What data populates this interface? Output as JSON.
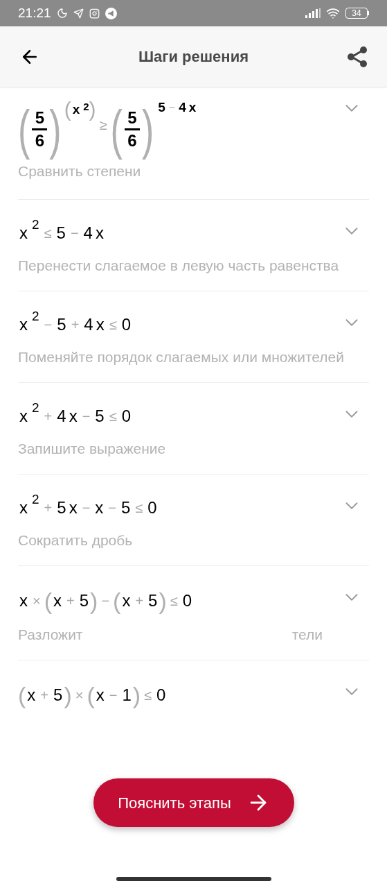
{
  "status_bar": {
    "time": "21:21",
    "battery": "34"
  },
  "header": {
    "title": "Шаги решения"
  },
  "steps": [
    {
      "formula": [
        {
          "kind": "pow",
          "base": [
            {
              "kind": "group",
              "open": "(",
              "close": ")",
              "items": [
                {
                  "kind": "frac",
                  "num": "5",
                  "den": "6"
                }
              ]
            }
          ],
          "exp": [
            {
              "kind": "group",
              "open": "(",
              "close": ")",
              "items": [
                {
                  "kind": "n",
                  "text": "x"
                },
                {
                  "kind": "sup",
                  "text": "2"
                }
              ]
            }
          ]
        },
        {
          "kind": "op",
          "text": "≥"
        },
        {
          "kind": "pow",
          "base": [
            {
              "kind": "group",
              "open": "(",
              "close": ")",
              "items": [
                {
                  "kind": "frac",
                  "num": "5",
                  "den": "6"
                }
              ]
            }
          ],
          "exp": [
            {
              "kind": "n",
              "text": "5"
            },
            {
              "kind": "op",
              "text": "−"
            },
            {
              "kind": "n",
              "text": "4"
            },
            {
              "kind": "n",
              "text": "x"
            }
          ]
        }
      ],
      "description": [
        "Сравнить степени"
      ]
    },
    {
      "formula": [
        {
          "kind": "n",
          "text": "x"
        },
        {
          "kind": "sup",
          "text": "2"
        },
        {
          "kind": "op",
          "text": "≤"
        },
        {
          "kind": "n",
          "text": "5"
        },
        {
          "kind": "op",
          "text": "−"
        },
        {
          "kind": "n",
          "text": "4"
        },
        {
          "kind": "n",
          "text": "x"
        }
      ],
      "description": [
        "Перенести слагаемое в левую часть равенства"
      ]
    },
    {
      "formula": [
        {
          "kind": "n",
          "text": "x"
        },
        {
          "kind": "sup",
          "text": "2"
        },
        {
          "kind": "op",
          "text": "−"
        },
        {
          "kind": "n",
          "text": "5"
        },
        {
          "kind": "op",
          "text": "+"
        },
        {
          "kind": "n",
          "text": "4"
        },
        {
          "kind": "n",
          "text": "x"
        },
        {
          "kind": "op",
          "text": "≤"
        },
        {
          "kind": "n",
          "text": "0"
        }
      ],
      "description": [
        "Поменяйте порядок слагаемых или множителей"
      ]
    },
    {
      "formula": [
        {
          "kind": "n",
          "text": "x"
        },
        {
          "kind": "sup",
          "text": "2"
        },
        {
          "kind": "op",
          "text": "+"
        },
        {
          "kind": "n",
          "text": "4"
        },
        {
          "kind": "n",
          "text": "x"
        },
        {
          "kind": "op",
          "text": "−"
        },
        {
          "kind": "n",
          "text": "5"
        },
        {
          "kind": "op",
          "text": "≤"
        },
        {
          "kind": "n",
          "text": "0"
        }
      ],
      "description": [
        "Запишите выражение"
      ]
    },
    {
      "formula": [
        {
          "kind": "n",
          "text": "x"
        },
        {
          "kind": "sup",
          "text": "2"
        },
        {
          "kind": "op",
          "text": "+"
        },
        {
          "kind": "n",
          "text": "5"
        },
        {
          "kind": "n",
          "text": "x"
        },
        {
          "kind": "op",
          "text": "−"
        },
        {
          "kind": "n",
          "text": "x"
        },
        {
          "kind": "op",
          "text": "−"
        },
        {
          "kind": "n",
          "text": "5"
        },
        {
          "kind": "op",
          "text": "≤"
        },
        {
          "kind": "n",
          "text": "0"
        }
      ],
      "description": [
        "Сократить дробь"
      ]
    },
    {
      "formula": [
        {
          "kind": "n",
          "text": "x"
        },
        {
          "kind": "op",
          "text": "×"
        },
        {
          "kind": "group",
          "open": "(",
          "close": ")",
          "items": [
            {
              "kind": "n",
              "text": "x"
            },
            {
              "kind": "op",
              "text": "+"
            },
            {
              "kind": "n",
              "text": "5"
            }
          ]
        },
        {
          "kind": "op",
          "text": "−"
        },
        {
          "kind": "group",
          "open": "(",
          "close": ")",
          "items": [
            {
              "kind": "n",
              "text": "x"
            },
            {
              "kind": "op",
              "text": "+"
            },
            {
              "kind": "n",
              "text": "5"
            }
          ]
        },
        {
          "kind": "op",
          "text": "≤"
        },
        {
          "kind": "n",
          "text": "0"
        }
      ],
      "description": [
        "Разложит",
        "тели"
      ]
    },
    {
      "formula": [
        {
          "kind": "group",
          "open": "(",
          "close": ")",
          "items": [
            {
              "kind": "n",
              "text": "x"
            },
            {
              "kind": "op",
              "text": "+"
            },
            {
              "kind": "n",
              "text": "5"
            }
          ]
        },
        {
          "kind": "op",
          "text": "×"
        },
        {
          "kind": "group",
          "open": "(",
          "close": ")",
          "items": [
            {
              "kind": "n",
              "text": "x"
            },
            {
              "kind": "op",
              "text": "−"
            },
            {
              "kind": "n",
              "text": "1"
            }
          ]
        },
        {
          "kind": "op",
          "text": "≤"
        },
        {
          "kind": "n",
          "text": "0"
        }
      ]
    }
  ],
  "action_button": {
    "label": "Пояснить этапы"
  }
}
